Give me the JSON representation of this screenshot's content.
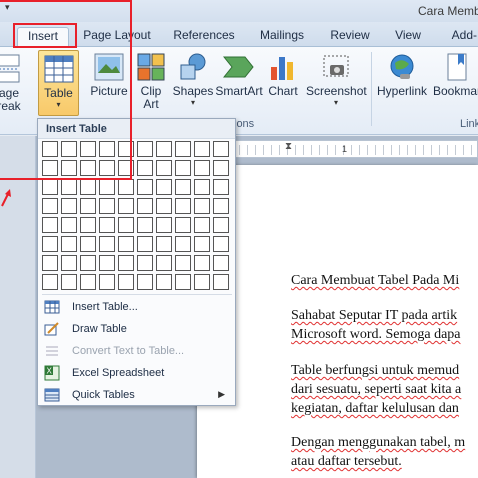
{
  "window": {
    "title": "Cara Memb"
  },
  "tabs": [
    {
      "label": "Insert",
      "active": true
    },
    {
      "label": "Page Layout"
    },
    {
      "label": "References"
    },
    {
      "label": "Mailings"
    },
    {
      "label": "Review"
    },
    {
      "label": "View"
    },
    {
      "label": "Add-I"
    }
  ],
  "ribbon": {
    "page_break": {
      "line1": "age",
      "line2": "reak"
    },
    "table": "Table",
    "picture": "Picture",
    "clip_art": {
      "line1": "Clip",
      "line2": "Art"
    },
    "shapes": "Shapes",
    "smartart": "SmartArt",
    "chart": "Chart",
    "screenshot": "Screenshot",
    "hyperlink": "Hyperlink",
    "bookmark": "Bookmar",
    "group_illustrations": "ions",
    "group_links": "Link"
  },
  "ruler": {
    "label": "1"
  },
  "menu": {
    "header": "Insert Table",
    "items": [
      {
        "label": "Insert Table...",
        "icon": "insert-table-icon",
        "disabled": false
      },
      {
        "label": "Draw Table",
        "icon": "draw-table-icon",
        "disabled": false
      },
      {
        "label": "Convert Text to Table...",
        "icon": "convert-text-icon",
        "disabled": true
      },
      {
        "label": "Excel Spreadsheet",
        "icon": "excel-icon",
        "disabled": false
      },
      {
        "label": "Quick Tables",
        "icon": "quick-tables-icon",
        "disabled": false,
        "submenu": true
      }
    ]
  },
  "document": {
    "title_line": "Cara Membuat Tabel Pada Mi",
    "p1": [
      "Sahabat Seputar IT pada artik",
      "Microsoft word. Semoga dapa"
    ],
    "p2": [
      "Table berfungsi untuk memud",
      "dari sesuatu, seperti saat kita a",
      "kegiatan, daftar kelulusan dan"
    ],
    "p3": [
      "Dengan menggunakan tabel, m",
      "atau daftar tersebut."
    ]
  },
  "colors": {
    "annotation": "#e8202a",
    "selected_button": "#f8c96a"
  }
}
